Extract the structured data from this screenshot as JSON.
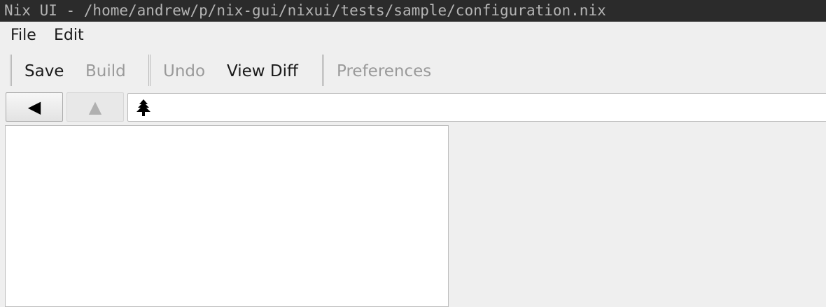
{
  "window": {
    "title": "Nix UI - /home/andrew/p/nix-gui/nixui/tests/sample/configuration.nix"
  },
  "menubar": {
    "items": [
      {
        "label": "File"
      },
      {
        "label": "Edit"
      }
    ]
  },
  "toolbar": {
    "save": {
      "label": "Save",
      "enabled": true
    },
    "build": {
      "label": "Build",
      "enabled": false
    },
    "undo": {
      "label": "Undo",
      "enabled": false
    },
    "view_diff": {
      "label": "View Diff",
      "enabled": true
    },
    "preferences": {
      "label": "Preferences",
      "enabled": false
    }
  },
  "navigation": {
    "back_icon": "◀",
    "up_icon": "▲",
    "path_icon": "tree-icon"
  },
  "colors": {
    "titlebar_bg": "#2b2b2b",
    "window_bg": "#efefef",
    "disabled_text": "#9a9a9a"
  }
}
